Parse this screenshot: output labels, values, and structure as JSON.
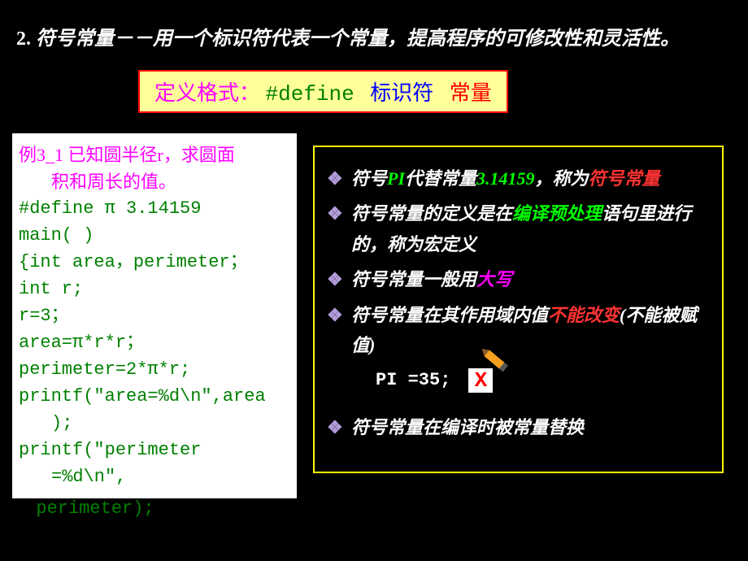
{
  "heading": {
    "number": "2.",
    "text": "符号常量－－用一个标识符代表一个常量，提高程序的可修改性和灵活性。"
  },
  "define_format": {
    "label": "定义格式：",
    "keyword": "#define",
    "identifier": "标识符",
    "constant": "常量"
  },
  "code_example": {
    "title_line1": "例3_1 已知圆半径r，求圆面",
    "title_line2": "积和周长的值。",
    "l1": "#define  π   3.14159",
    "l2": "main( )",
    "l3": "{int area，perimeter；",
    "l4": " int r;",
    "l5": " r=3；",
    "l6": " area=π*r*r；",
    "l7": " perimeter=2*π*r;",
    "l8": "printf(\"area=%d\\n\",area",
    "l8b": ");",
    "l9": "printf(\"perimeter",
    "l9b": "=%d\\n\",",
    "l10": "perimeter);"
  },
  "notes": {
    "n1_a": "符号",
    "n1_b": "PI",
    "n1_c": "代替常量",
    "n1_d": "3.14159",
    "n1_e": "，称为",
    "n1_f": "符号常量",
    "n2_a": "符号常量的定义是在",
    "n2_b": "编译预处理",
    "n2_c": "语句里进行的，称为宏定义",
    "n3_a": "符号常量一般用",
    "n3_b": "大写",
    "n4_a": "符号常量在其作用域内值",
    "n4_b": "不能改变",
    "n4_c": "(不能被赋值)",
    "pi_stmt": "PI =35;",
    "cross": "X",
    "n5": "符号常量在编译时被常量替换"
  }
}
